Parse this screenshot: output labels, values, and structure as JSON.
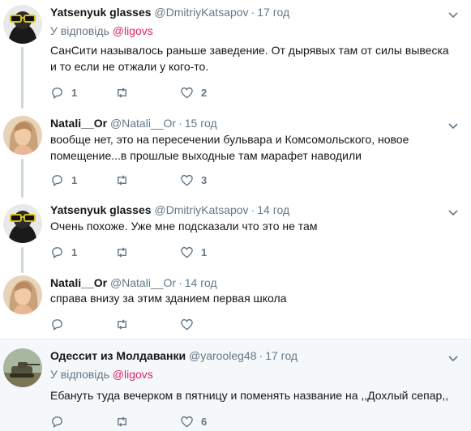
{
  "tweets": [
    {
      "name": "Yatsenyuk glasses",
      "handle": "@DmitriyKatsapov",
      "time": "17 год",
      "reply_prefix": "У відповідь",
      "reply_mention": "@ligovs",
      "text": "СанСити называлось раньше заведение. От дырявых там от силы вывеска и то если не отжали у кого-то.",
      "replies": "1",
      "retweets": "",
      "likes": "2",
      "avatar_icon": "glasses-avatar-icon"
    },
    {
      "name": "Natali__Or",
      "handle": "@Natali__Or",
      "time": "15 год",
      "text": "вообще нет, это на пересечении бульвара и Комсомольского, новое помещение...в прошлые выходные там марафет наводили",
      "replies": "1",
      "retweets": "",
      "likes": "3",
      "avatar_icon": "woman-avatar-icon"
    },
    {
      "name": "Yatsenyuk glasses",
      "handle": "@DmitriyKatsapov",
      "time": "14 год",
      "text": "Очень похоже. Уже мне подсказали что это не там",
      "replies": "1",
      "retweets": "",
      "likes": "1",
      "avatar_icon": "glasses-avatar-icon"
    },
    {
      "name": "Natali__Or",
      "handle": "@Natali__Or",
      "time": "14 год",
      "text": "справа внизу за этим зданием первая школа",
      "replies": "",
      "retweets": "",
      "likes": "",
      "avatar_icon": "woman-avatar-icon"
    },
    {
      "name": "Одессит из Молдаванки",
      "handle": "@yarooleg48",
      "time": "17 год",
      "reply_prefix": "У відповідь",
      "reply_mention": "@ligovs",
      "text": "Ебануть туда вечерком в пятницу и поменять название на ,,Дохлый сепар,,",
      "replies": "",
      "retweets": "",
      "likes": "6",
      "avatar_icon": "tank-avatar-icon"
    }
  ],
  "colors": {
    "name": "#14171a",
    "secondary": "#657786",
    "mention": "#e0245e",
    "thread_line": "#ccd6dd",
    "highlight_bg": "#f5f8fa"
  }
}
